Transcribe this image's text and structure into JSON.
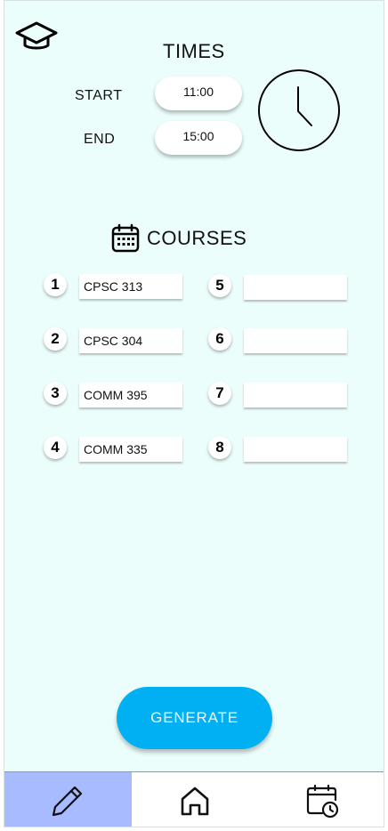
{
  "header": {
    "logo_icon": "graduation-cap-icon"
  },
  "times": {
    "title": "TIMES",
    "start_label": "START",
    "start_value": "11:00",
    "end_label": "END",
    "end_value": "15:00",
    "clock_icon": "clock-icon"
  },
  "courses": {
    "title": "COURSES",
    "icon": "calendar-icon",
    "slots": [
      {
        "number": "1",
        "value": "CPSC 313"
      },
      {
        "number": "2",
        "value": "CPSC 304"
      },
      {
        "number": "3",
        "value": "COMM 395"
      },
      {
        "number": "4",
        "value": "COMM 335"
      },
      {
        "number": "5",
        "value": ""
      },
      {
        "number": "6",
        "value": ""
      },
      {
        "number": "7",
        "value": ""
      },
      {
        "number": "8",
        "value": ""
      }
    ]
  },
  "generate_label": "GENERATE",
  "nav": {
    "items": [
      {
        "icon": "pencil-icon",
        "active": true
      },
      {
        "icon": "home-icon",
        "active": false
      },
      {
        "icon": "calendar-clock-icon",
        "active": false
      }
    ]
  },
  "colors": {
    "background": "#ecfefc",
    "accent": "#00b0f3",
    "nav_active": "#a8bbff"
  }
}
